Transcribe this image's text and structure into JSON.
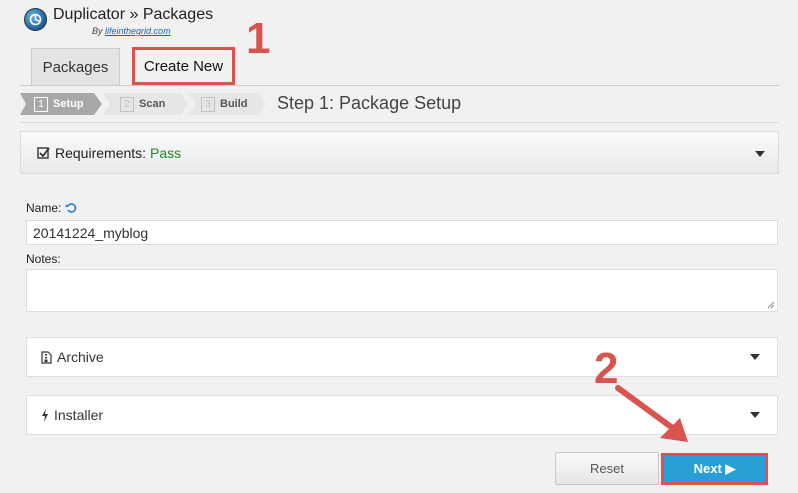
{
  "header": {
    "title": "Duplicator » Packages",
    "byline_prefix": "By",
    "byline_link": "lifeinthegrid.com",
    "logo_icon": "duplicator-logo-icon"
  },
  "tabs": [
    {
      "label": "Packages",
      "active": false
    },
    {
      "label": "Create New",
      "active": true
    }
  ],
  "annotations": {
    "one": "1",
    "two": "2",
    "highlight_color": "#d9534f"
  },
  "wizard": {
    "steps": [
      {
        "num": "1",
        "label": "Setup",
        "active": true
      },
      {
        "num": "2",
        "label": "Scan",
        "active": false
      },
      {
        "num": "3",
        "label": "Build",
        "active": false
      }
    ],
    "title": "Step 1: Package Setup"
  },
  "requirements": {
    "label": "Requirements:",
    "status": "Pass",
    "status_color": "#1f8a1f",
    "icon": "checkbox-icon"
  },
  "form": {
    "name_label": "Name:",
    "name_value": "20141224_myblog",
    "notes_label": "Notes:",
    "notes_value": "",
    "reset_icon": "undo-icon"
  },
  "panels": {
    "archive": "Archive",
    "installer": "Installer"
  },
  "buttons": {
    "reset": "Reset",
    "next": "Next ▶",
    "next_color": "#2a9fd6"
  }
}
